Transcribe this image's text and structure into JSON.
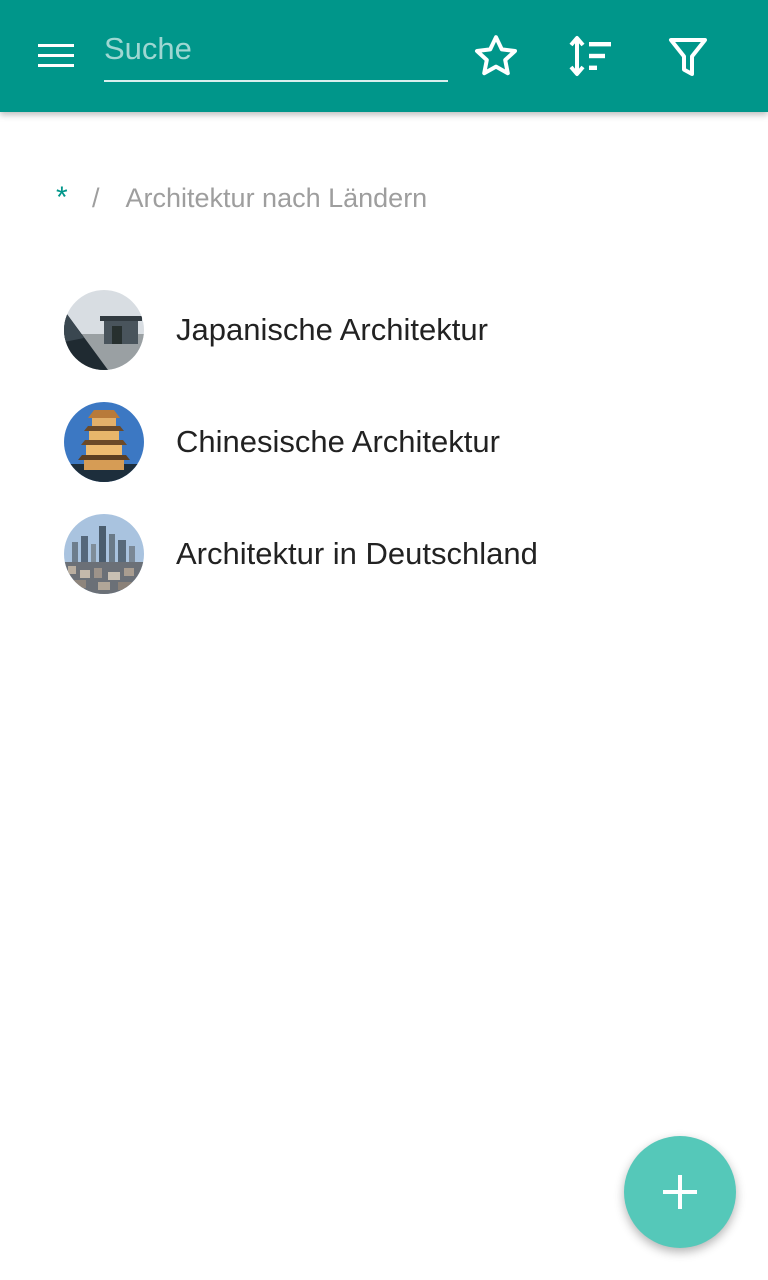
{
  "appbar": {
    "color": "#00968a",
    "menu_icon": "menu-icon",
    "search": {
      "placeholder": "Suche",
      "value": ""
    },
    "actions": [
      "star-icon",
      "sort-icon",
      "filter-icon"
    ]
  },
  "breadcrumb": {
    "root": "*",
    "separator": "/",
    "current": "Architektur nach Ländern"
  },
  "list": {
    "items": [
      {
        "label": "Japanische Architektur"
      },
      {
        "label": "Chinesische Architektur"
      },
      {
        "label": "Architektur in Deutschland"
      }
    ]
  },
  "fab": {
    "icon": "plus-icon",
    "color": "#55c8b9"
  }
}
